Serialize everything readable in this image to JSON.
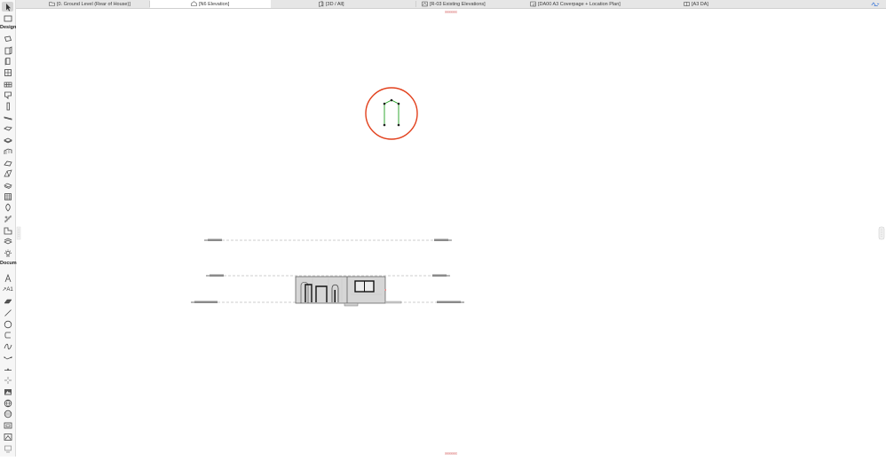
{
  "tabs": [
    {
      "label": "[0. Ground Level (Rear of House)]",
      "icon": "floor-plan-icon"
    },
    {
      "label": "[N6 Elevation]",
      "icon": "elevation-icon",
      "active": true
    },
    {
      "label": "[3D / All]",
      "icon": "3d-icon"
    },
    {
      "label": "[R-03 Existing Elevations]",
      "icon": "layout-icon"
    },
    {
      "label": "[DA00 A3 Coverpage + Location Plan]",
      "icon": "layout-icon"
    },
    {
      "label": "[A3 DA]",
      "icon": "book-icon"
    }
  ],
  "toolbox": {
    "design_label": "Design",
    "document_label": "Docum",
    "dimension_tool_label": "A1"
  },
  "colors": {
    "marker_ring": "#e2401c",
    "selection_green": "#1fa21f",
    "level_line": "#9a9a9a",
    "building_fill": "#d6d6d6",
    "handle_red": "#e58a8a"
  }
}
